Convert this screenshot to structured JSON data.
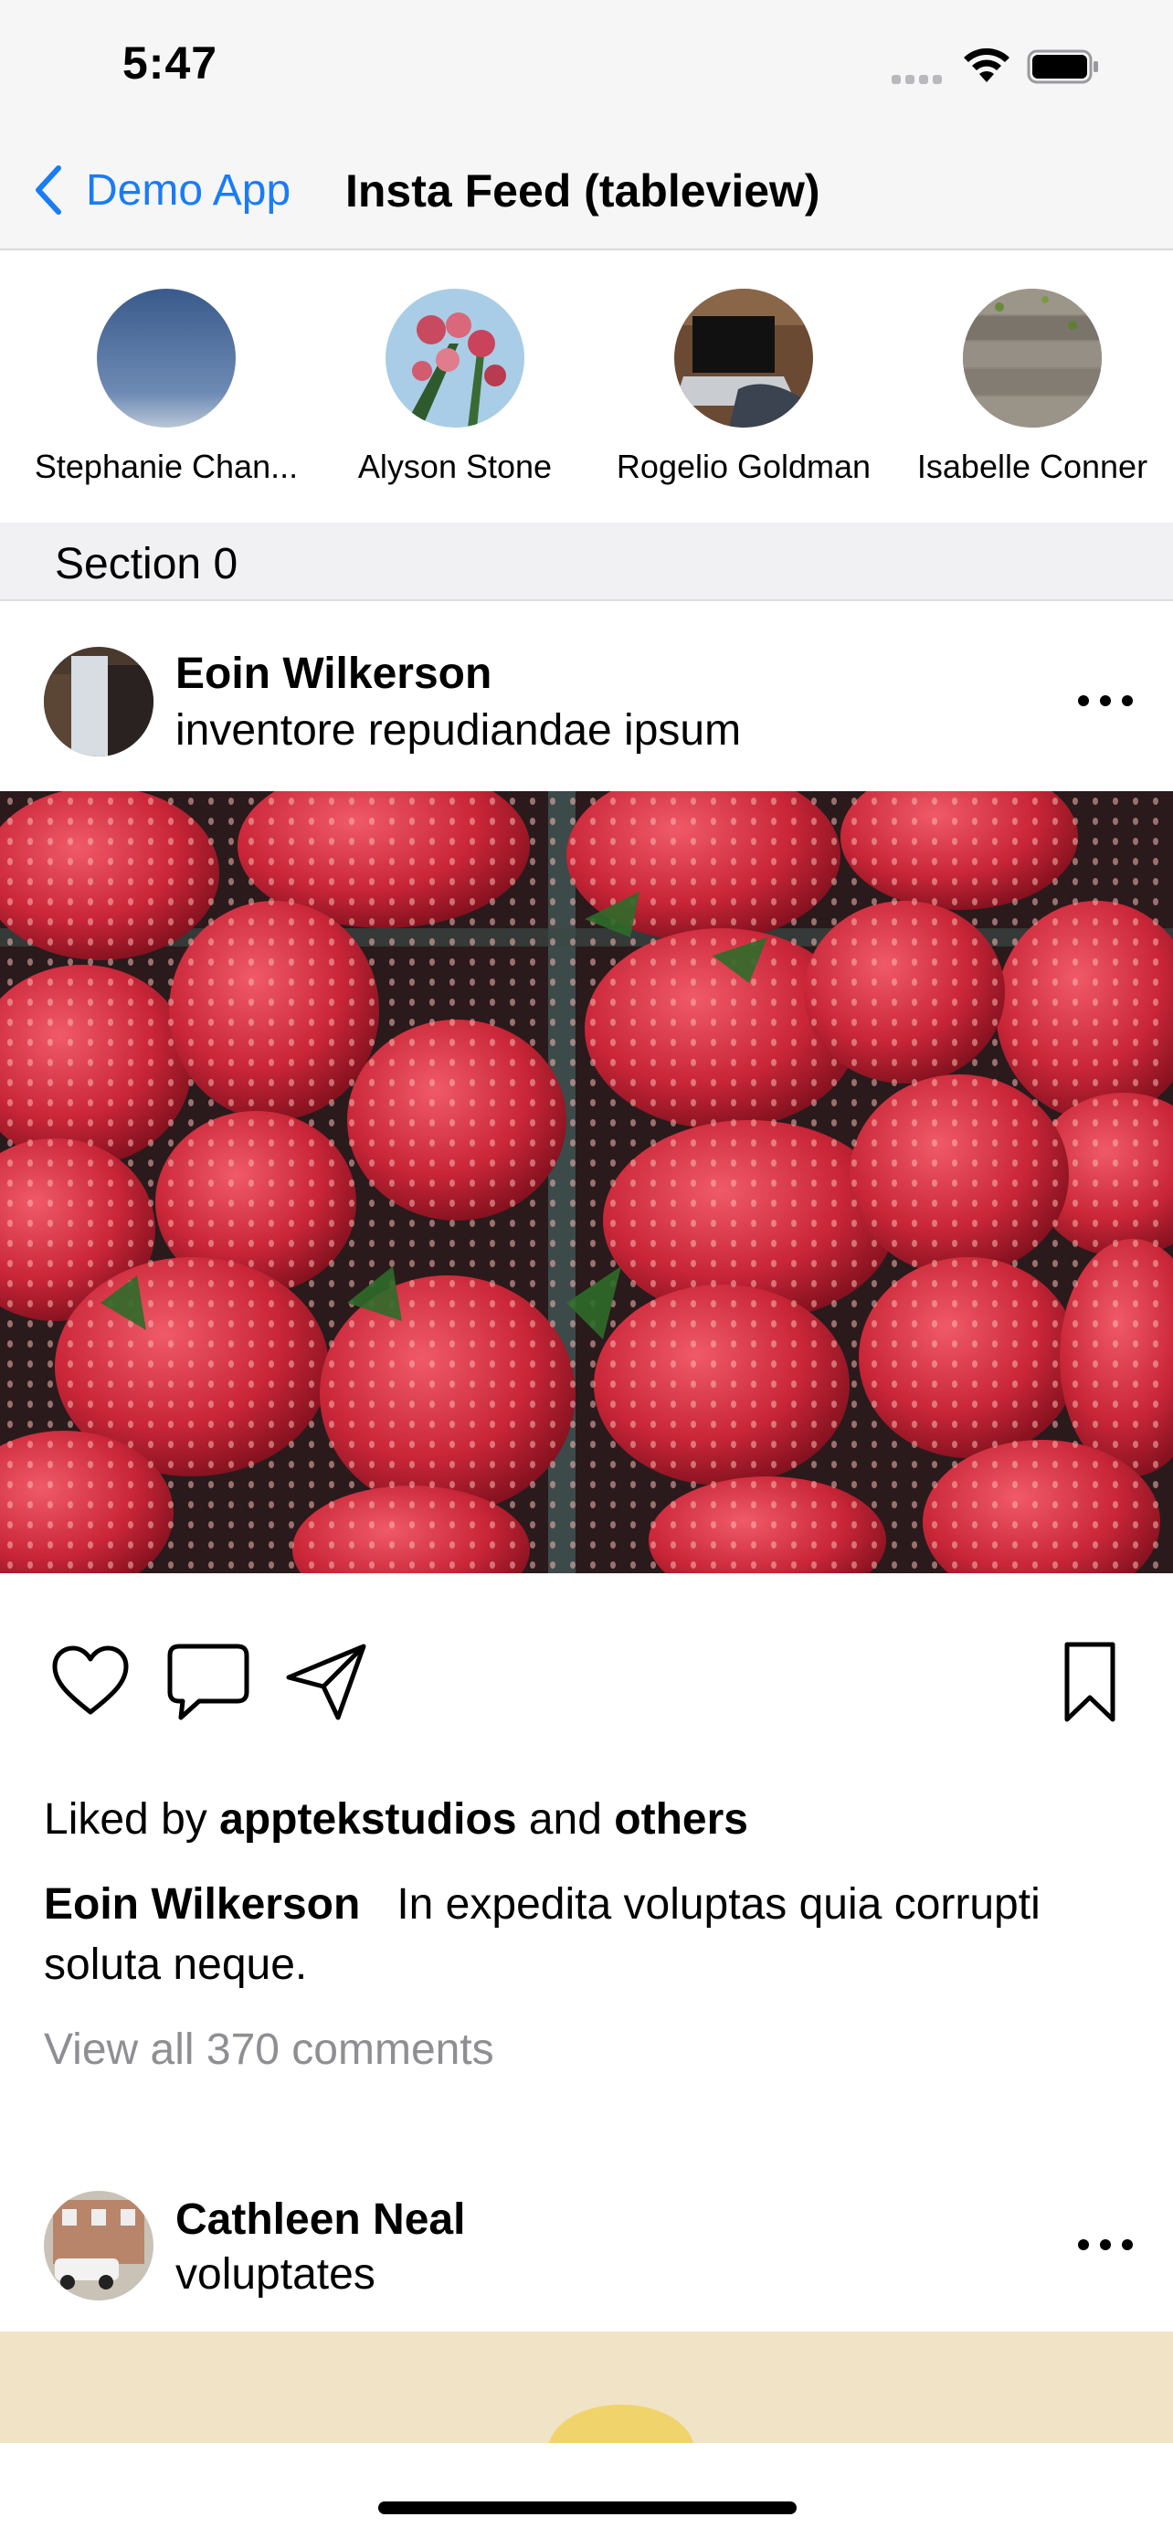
{
  "status_bar": {
    "time": "5:47"
  },
  "nav": {
    "back_label": "Demo App",
    "title": "Insta Feed (tableview)"
  },
  "stories": [
    {
      "name": "Stephanie Chan..."
    },
    {
      "name": "Alyson Stone"
    },
    {
      "name": "Rogelio Goldman"
    },
    {
      "name": "Isabelle Conner"
    }
  ],
  "section": {
    "title": "Section 0"
  },
  "posts": [
    {
      "user": "Eoin Wilkerson",
      "subtitle": "inventore repudiandae ipsum",
      "likes_prefix": "Liked by",
      "likes_user": "apptekstudios",
      "likes_and": "and",
      "likes_others": "others",
      "caption_user": "Eoin Wilkerson",
      "caption_text": "In expedita voluptas quia corrupti soluta neque.",
      "comments_link": "View all 370 comments"
    },
    {
      "user": "Cathleen Neal",
      "subtitle": "voluptates"
    }
  ],
  "colors": {
    "accent": "#1a7cf5",
    "secondary_text": "#8e8e93"
  },
  "icons": [
    "back-chevron-icon",
    "wifi-icon",
    "battery-icon",
    "more-icon",
    "heart-icon",
    "comment-icon",
    "share-icon",
    "bookmark-icon"
  ]
}
